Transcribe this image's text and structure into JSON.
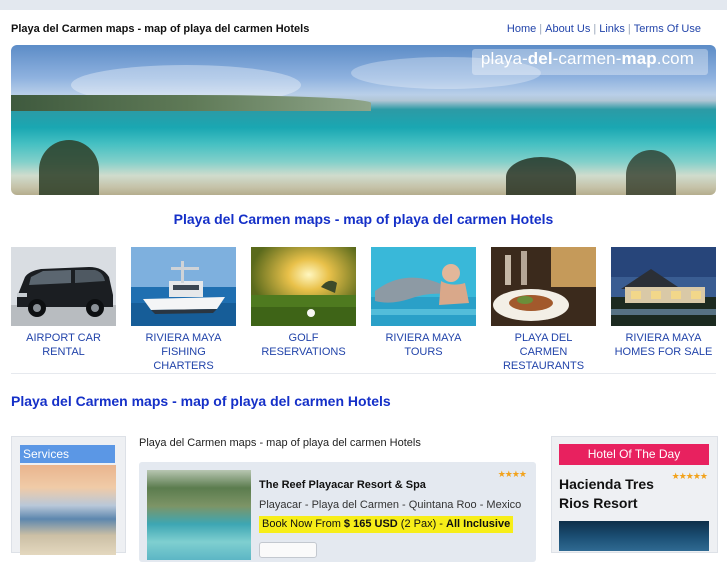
{
  "header": {
    "site_title": "Playa del Carmen maps - map of playa del carmen Hotels",
    "nav": [
      {
        "label": "Home"
      },
      {
        "label": "About Us"
      },
      {
        "label": "Links"
      },
      {
        "label": "Terms Of Use"
      }
    ],
    "nav_separator": "|"
  },
  "banner": {
    "logo_prefix": "playa-",
    "logo_bold1": "del",
    "logo_mid": "-carmen-",
    "logo_bold2": "map",
    "logo_suffix": ".com"
  },
  "headline_top": "Playa del Carmen maps - map of playa del carmen Hotels",
  "tiles": [
    {
      "line1": "AIRPORT CAR",
      "line2": "RENTAL",
      "icon": "minivan-photo"
    },
    {
      "line1": "RIVIERA MAYA",
      "line2": "FISHING CHARTERS",
      "icon": "fishing-boat-photo"
    },
    {
      "line1": "GOLF",
      "line2": "RESERVATIONS",
      "icon": "golf-course-photo"
    },
    {
      "line1": "RIVIERA MAYA",
      "line2": "TOURS",
      "icon": "dolphin-swim-photo"
    },
    {
      "line1": "PLAYA DEL CARMEN",
      "line2": "RESTAURANTS",
      "icon": "restaurant-dish-photo"
    },
    {
      "line1": "RIVIERA MAYA",
      "line2": "HOMES FOR SALE",
      "icon": "villa-photo"
    }
  ],
  "headline_section": "Playa del Carmen maps - map of playa del carmen Hotels",
  "services_panel": {
    "title": "Services"
  },
  "center": {
    "intro": "Playa del Carmen maps - map of playa del carmen Hotels",
    "hotel": {
      "name": "The Reef Playacar Resort & Spa",
      "stars": 4,
      "location": "Playacar - Playa del Carmen - Quintana Roo - Mexico",
      "book_prefix": "Book Now From ",
      "price": "$ 165 USD",
      "pax": " (2 Pax) - ",
      "plan": "All Inclusive"
    }
  },
  "hotel_of_day": {
    "title": "Hotel Of The Day",
    "stars": 5,
    "name": "Hacienda Tres Rios Resort"
  },
  "colors": {
    "link": "#2244aa",
    "headline": "#1530c8",
    "services_title_bg": "#5b97e5",
    "hotel_day_title_bg": "#e8215f",
    "book_highlight": "#f7ee19",
    "stars": "#f2a21b"
  }
}
